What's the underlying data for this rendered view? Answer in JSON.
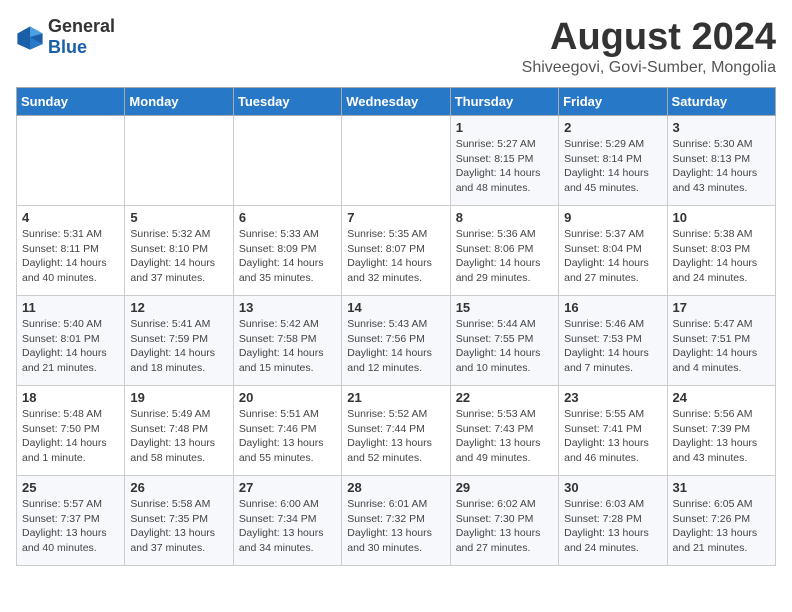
{
  "header": {
    "logo_general": "General",
    "logo_blue": "Blue",
    "month_title": "August 2024",
    "location": "Shiveegovi, Govi-Sumber, Mongolia"
  },
  "days_of_week": [
    "Sunday",
    "Monday",
    "Tuesday",
    "Wednesday",
    "Thursday",
    "Friday",
    "Saturday"
  ],
  "weeks": [
    [
      {
        "day": "",
        "info": ""
      },
      {
        "day": "",
        "info": ""
      },
      {
        "day": "",
        "info": ""
      },
      {
        "day": "",
        "info": ""
      },
      {
        "day": "1",
        "info": "Sunrise: 5:27 AM\nSunset: 8:15 PM\nDaylight: 14 hours\nand 48 minutes."
      },
      {
        "day": "2",
        "info": "Sunrise: 5:29 AM\nSunset: 8:14 PM\nDaylight: 14 hours\nand 45 minutes."
      },
      {
        "day": "3",
        "info": "Sunrise: 5:30 AM\nSunset: 8:13 PM\nDaylight: 14 hours\nand 43 minutes."
      }
    ],
    [
      {
        "day": "4",
        "info": "Sunrise: 5:31 AM\nSunset: 8:11 PM\nDaylight: 14 hours\nand 40 minutes."
      },
      {
        "day": "5",
        "info": "Sunrise: 5:32 AM\nSunset: 8:10 PM\nDaylight: 14 hours\nand 37 minutes."
      },
      {
        "day": "6",
        "info": "Sunrise: 5:33 AM\nSunset: 8:09 PM\nDaylight: 14 hours\nand 35 minutes."
      },
      {
        "day": "7",
        "info": "Sunrise: 5:35 AM\nSunset: 8:07 PM\nDaylight: 14 hours\nand 32 minutes."
      },
      {
        "day": "8",
        "info": "Sunrise: 5:36 AM\nSunset: 8:06 PM\nDaylight: 14 hours\nand 29 minutes."
      },
      {
        "day": "9",
        "info": "Sunrise: 5:37 AM\nSunset: 8:04 PM\nDaylight: 14 hours\nand 27 minutes."
      },
      {
        "day": "10",
        "info": "Sunrise: 5:38 AM\nSunset: 8:03 PM\nDaylight: 14 hours\nand 24 minutes."
      }
    ],
    [
      {
        "day": "11",
        "info": "Sunrise: 5:40 AM\nSunset: 8:01 PM\nDaylight: 14 hours\nand 21 minutes."
      },
      {
        "day": "12",
        "info": "Sunrise: 5:41 AM\nSunset: 7:59 PM\nDaylight: 14 hours\nand 18 minutes."
      },
      {
        "day": "13",
        "info": "Sunrise: 5:42 AM\nSunset: 7:58 PM\nDaylight: 14 hours\nand 15 minutes."
      },
      {
        "day": "14",
        "info": "Sunrise: 5:43 AM\nSunset: 7:56 PM\nDaylight: 14 hours\nand 12 minutes."
      },
      {
        "day": "15",
        "info": "Sunrise: 5:44 AM\nSunset: 7:55 PM\nDaylight: 14 hours\nand 10 minutes."
      },
      {
        "day": "16",
        "info": "Sunrise: 5:46 AM\nSunset: 7:53 PM\nDaylight: 14 hours\nand 7 minutes."
      },
      {
        "day": "17",
        "info": "Sunrise: 5:47 AM\nSunset: 7:51 PM\nDaylight: 14 hours\nand 4 minutes."
      }
    ],
    [
      {
        "day": "18",
        "info": "Sunrise: 5:48 AM\nSunset: 7:50 PM\nDaylight: 14 hours\nand 1 minute."
      },
      {
        "day": "19",
        "info": "Sunrise: 5:49 AM\nSunset: 7:48 PM\nDaylight: 13 hours\nand 58 minutes."
      },
      {
        "day": "20",
        "info": "Sunrise: 5:51 AM\nSunset: 7:46 PM\nDaylight: 13 hours\nand 55 minutes."
      },
      {
        "day": "21",
        "info": "Sunrise: 5:52 AM\nSunset: 7:44 PM\nDaylight: 13 hours\nand 52 minutes."
      },
      {
        "day": "22",
        "info": "Sunrise: 5:53 AM\nSunset: 7:43 PM\nDaylight: 13 hours\nand 49 minutes."
      },
      {
        "day": "23",
        "info": "Sunrise: 5:55 AM\nSunset: 7:41 PM\nDaylight: 13 hours\nand 46 minutes."
      },
      {
        "day": "24",
        "info": "Sunrise: 5:56 AM\nSunset: 7:39 PM\nDaylight: 13 hours\nand 43 minutes."
      }
    ],
    [
      {
        "day": "25",
        "info": "Sunrise: 5:57 AM\nSunset: 7:37 PM\nDaylight: 13 hours\nand 40 minutes."
      },
      {
        "day": "26",
        "info": "Sunrise: 5:58 AM\nSunset: 7:35 PM\nDaylight: 13 hours\nand 37 minutes."
      },
      {
        "day": "27",
        "info": "Sunrise: 6:00 AM\nSunset: 7:34 PM\nDaylight: 13 hours\nand 34 minutes."
      },
      {
        "day": "28",
        "info": "Sunrise: 6:01 AM\nSunset: 7:32 PM\nDaylight: 13 hours\nand 30 minutes."
      },
      {
        "day": "29",
        "info": "Sunrise: 6:02 AM\nSunset: 7:30 PM\nDaylight: 13 hours\nand 27 minutes."
      },
      {
        "day": "30",
        "info": "Sunrise: 6:03 AM\nSunset: 7:28 PM\nDaylight: 13 hours\nand 24 minutes."
      },
      {
        "day": "31",
        "info": "Sunrise: 6:05 AM\nSunset: 7:26 PM\nDaylight: 13 hours\nand 21 minutes."
      }
    ]
  ]
}
